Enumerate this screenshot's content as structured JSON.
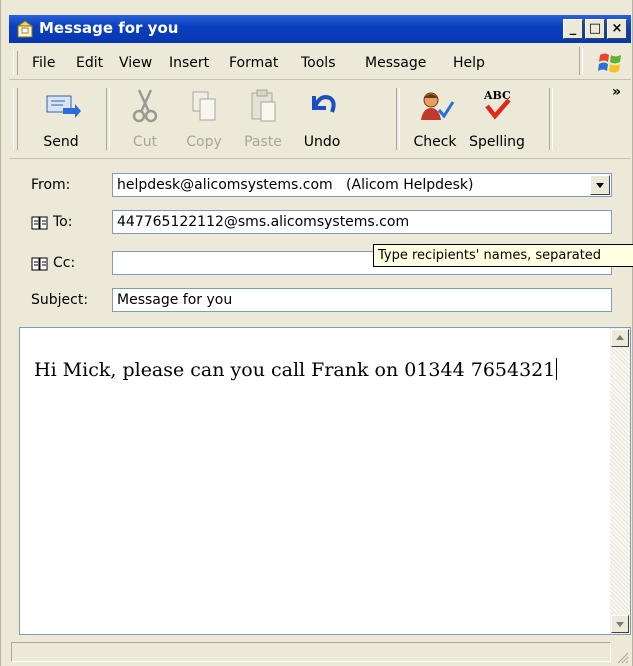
{
  "window": {
    "title": "Message for you",
    "controls": {
      "minimize": "_",
      "maximize": "□",
      "close": "×"
    }
  },
  "menu": {
    "items": [
      "File",
      "Edit",
      "View",
      "Insert",
      "Format",
      "Tools",
      "Message",
      "Help"
    ]
  },
  "toolbar": {
    "buttons": [
      {
        "label": "Send",
        "icon": "send-icon",
        "enabled": true
      },
      {
        "label": "Cut",
        "icon": "scissors-icon",
        "enabled": false
      },
      {
        "label": "Copy",
        "icon": "copy-icon",
        "enabled": false
      },
      {
        "label": "Paste",
        "icon": "paste-icon",
        "enabled": false
      },
      {
        "label": "Undo",
        "icon": "undo-icon",
        "enabled": true
      },
      {
        "label": "Check",
        "icon": "check-names-icon",
        "enabled": true
      },
      {
        "label": "Spelling",
        "icon": "spelling-icon",
        "enabled": true
      }
    ],
    "overflow": "»",
    "spelling_glyph": "ABC"
  },
  "headers": {
    "from_label": "From:",
    "from_value": "helpdesk@alicomsystems.com   (Alicom Helpdesk)",
    "to_label": "To:",
    "to_value": "447765122112@sms.alicomsystems.com",
    "cc_label": "Cc:",
    "cc_value": "",
    "subject_label": "Subject:",
    "subject_value": "Message for you"
  },
  "tooltip": "Type recipients' names, separated",
  "body": {
    "text": "Hi Mick, please can you call Frank on 01344 7654321"
  },
  "colors": {
    "titlebar": "#0a3fbf",
    "face": "#ece9d8",
    "field_border": "#7f9db9",
    "tooltip_bg": "#ffffe1"
  }
}
